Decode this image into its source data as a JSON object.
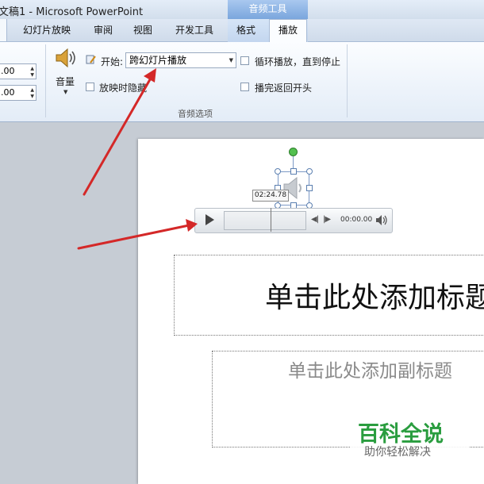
{
  "window": {
    "title": "文稿1 - Microsoft PowerPoint"
  },
  "ribbon": {
    "context_header": "音频工具",
    "tabs": [
      "幻灯片放映",
      "审阅",
      "视图",
      "开发工具",
      "格式",
      "播放"
    ],
    "active_tab": "播放",
    "spin_values": [
      ".00",
      ".00"
    ],
    "volume_label": "音量",
    "start_label": "开始:",
    "start_value": "跨幻灯片播放",
    "hide_label": "放映时隐藏",
    "loop_label": "循环播放，直到停止",
    "rewind_label": "播完返回开头",
    "group_label": "音频选项"
  },
  "player": {
    "tooltip_time": "02:24.78",
    "time": "00:00.00"
  },
  "slide": {
    "title_placeholder": "单击此处添加标题",
    "subtitle_placeholder": "单击此处添加副标题"
  },
  "watermark": {
    "main": "百科全说",
    "sub": "助你轻松解决"
  },
  "colors": {
    "accent": "#2a9d3f",
    "arrow": "#d42828"
  }
}
